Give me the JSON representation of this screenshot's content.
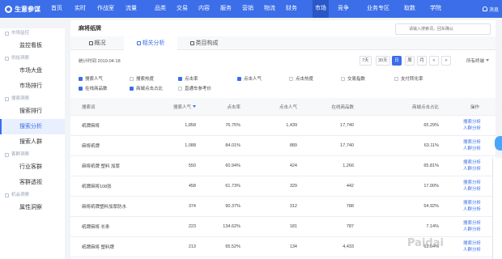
{
  "app": {
    "name": "生意参谋"
  },
  "nav": [
    "首页",
    "实时",
    "作战室",
    "流量",
    "品类",
    "交易",
    "内容",
    "服务",
    "营销",
    "物流",
    "财务",
    "市场",
    "竞争",
    "业务专区",
    "取数",
    "学院"
  ],
  "nav_active": "市场",
  "nav_badges": [
    "品类",
    "服务",
    "物流"
  ],
  "message_label": "消息",
  "sidebar": {
    "groups": [
      {
        "label": "市场监控",
        "items": [
          {
            "label": "监控看板",
            "active": false
          }
        ]
      },
      {
        "label": "供给洞察",
        "items": [
          {
            "label": "市场大盘",
            "active": false
          },
          {
            "label": "市场排行",
            "active": false
          }
        ]
      },
      {
        "label": "搜索洞察",
        "items": [
          {
            "label": "搜索排行",
            "active": false
          },
          {
            "label": "搜索分析",
            "active": true
          },
          {
            "label": "搜索人群",
            "active": false
          }
        ]
      },
      {
        "label": "客群洞察",
        "items": [
          {
            "label": "行业客群",
            "active": false
          },
          {
            "label": "客群透视",
            "active": false
          }
        ]
      },
      {
        "label": "机会洞察",
        "items": [
          {
            "label": "属性洞察",
            "active": false
          }
        ]
      }
    ]
  },
  "page": {
    "title": "麻将纸牌",
    "search_placeholder": "请输入搜索词，回车确认"
  },
  "tabs": [
    {
      "label": "概况",
      "active": false
    },
    {
      "label": "相关分析",
      "active": true
    },
    {
      "label": "类目构成",
      "active": false
    }
  ],
  "toolbar": {
    "stat_time": "统计时间 2019-04-18",
    "periods": [
      {
        "label": "7天",
        "active": false
      },
      {
        "label": "30天",
        "active": false
      },
      {
        "label": "日",
        "active": true
      },
      {
        "label": "周",
        "active": false
      },
      {
        "label": "月",
        "active": false
      },
      {
        "label": "<",
        "active": false
      },
      {
        "label": ">",
        "active": false
      }
    ],
    "device": "所有终端"
  },
  "filters": [
    [
      {
        "label": "搜索人气",
        "checked": true
      },
      {
        "label": "搜索热度",
        "checked": false
      },
      {
        "label": "点击率",
        "checked": true
      },
      {
        "label": "点击人气",
        "checked": true
      },
      {
        "label": "点击热度",
        "checked": false
      },
      {
        "label": "交易指数",
        "checked": false
      },
      {
        "label": "支付转化率",
        "checked": false
      }
    ],
    [
      {
        "label": "在线商品数",
        "checked": true
      },
      {
        "label": "商城点击占比",
        "checked": true
      },
      {
        "label": "直通车参考价",
        "checked": false
      }
    ]
  ],
  "table": {
    "columns": [
      "搜索词",
      "搜索人气",
      "点击率",
      "点击人气",
      "在线商品数",
      "商城点击占比",
      "操作"
    ],
    "sort_column": "搜索人气",
    "rows": [
      {
        "term": "纸牌麻将",
        "search_pop": "1,858",
        "ctr": "76.75%",
        "click_pop": "1,439",
        "items": "17,740",
        "mall_share": "65.29%"
      },
      {
        "term": "麻将纸牌",
        "search_pop": "1,088",
        "ctr": "84.01%",
        "click_pop": "889",
        "items": "17,740",
        "mall_share": "63.11%"
      },
      {
        "term": "麻将纸牌 塑料 加厚",
        "search_pop": "550",
        "ctr": "60.94%",
        "click_pop": "424",
        "items": "1,266",
        "mall_share": "65.81%"
      },
      {
        "term": "纸牌麻将108张",
        "search_pop": "458",
        "ctr": "61.73%",
        "click_pop": "329",
        "items": "442",
        "mall_share": "17.00%"
      },
      {
        "term": "麻将纸牌塑料加厚防水",
        "search_pop": "374",
        "ctr": "90.37%",
        "click_pop": "312",
        "items": "788",
        "mall_share": "54.92%"
      },
      {
        "term": "纸牌麻将 长条",
        "search_pop": "223",
        "ctr": "134.62%",
        "click_pop": "181",
        "items": "787",
        "mall_share": "7.14%"
      },
      {
        "term": "纸牌麻将 塑料牌",
        "search_pop": "213",
        "ctr": "65.52%",
        "click_pop": "134",
        "items": "4,433",
        "mall_share": "63.64%"
      }
    ],
    "ops": [
      "搜索分析",
      "人群分析"
    ]
  },
  "watermark": "Paidai",
  "colors": {
    "brand": "#3b6ee8",
    "nav_active_bg": "#2a57c7",
    "link": "#3b6ee8"
  }
}
